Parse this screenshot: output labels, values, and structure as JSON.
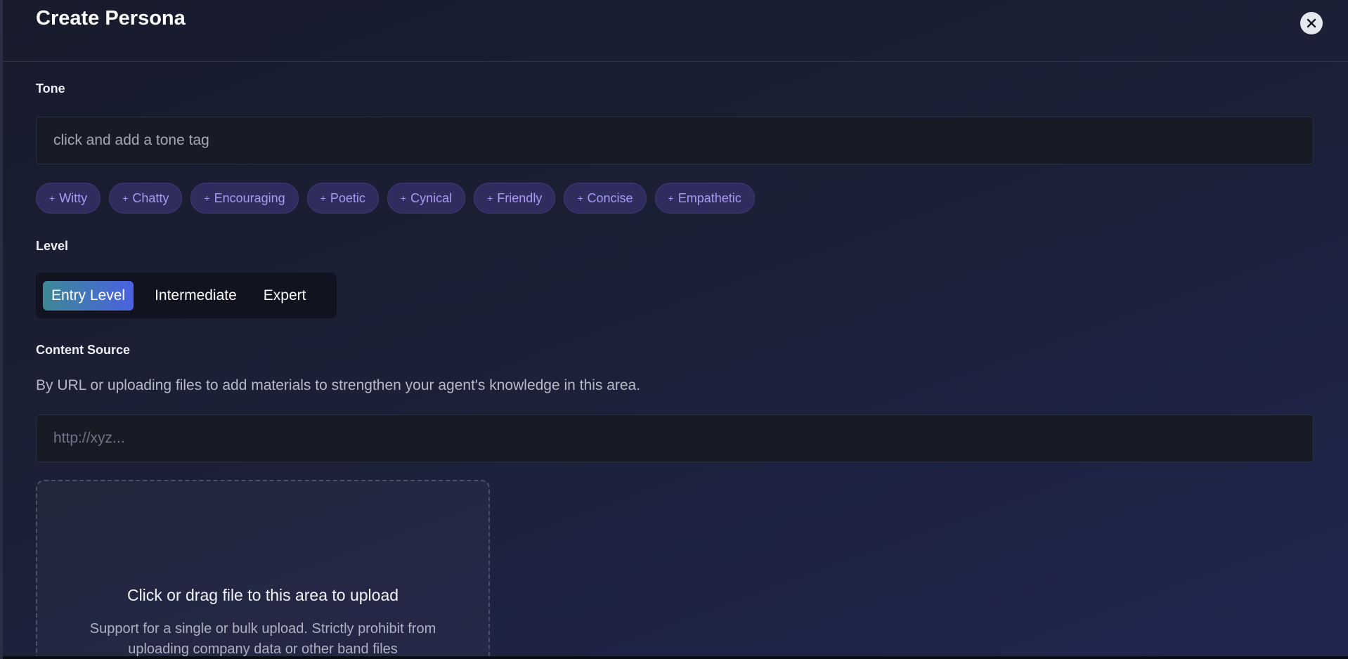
{
  "modal": {
    "title": "Create Persona",
    "close_icon": "close-icon"
  },
  "tone": {
    "label": "Tone",
    "placeholder": "click and add a tone tag",
    "tags": [
      "Witty",
      "Chatty",
      "Encouraging",
      "Poetic",
      "Cynical",
      "Friendly",
      "Concise",
      "Empathetic"
    ],
    "tag_prefix": "+"
  },
  "level": {
    "label": "Level",
    "options": [
      "Entry Level",
      "Intermediate",
      "Expert"
    ],
    "selected": "Entry Level"
  },
  "content_source": {
    "label": "Content Source",
    "description": "By URL or uploading files to add materials to strengthen your agent's knowledge in this area.",
    "url_placeholder": "http://xyz...",
    "upload_title": "Click or drag file to this area to upload",
    "upload_hint": "Support for a single or bulk upload. Strictly prohibit from uploading company data or other band files"
  },
  "colors": {
    "accent_gradient_start": "#3d8896",
    "accent_gradient_end": "#4a62e2",
    "tag_text": "#a99af2",
    "tag_bg": "#2e2d5e"
  }
}
